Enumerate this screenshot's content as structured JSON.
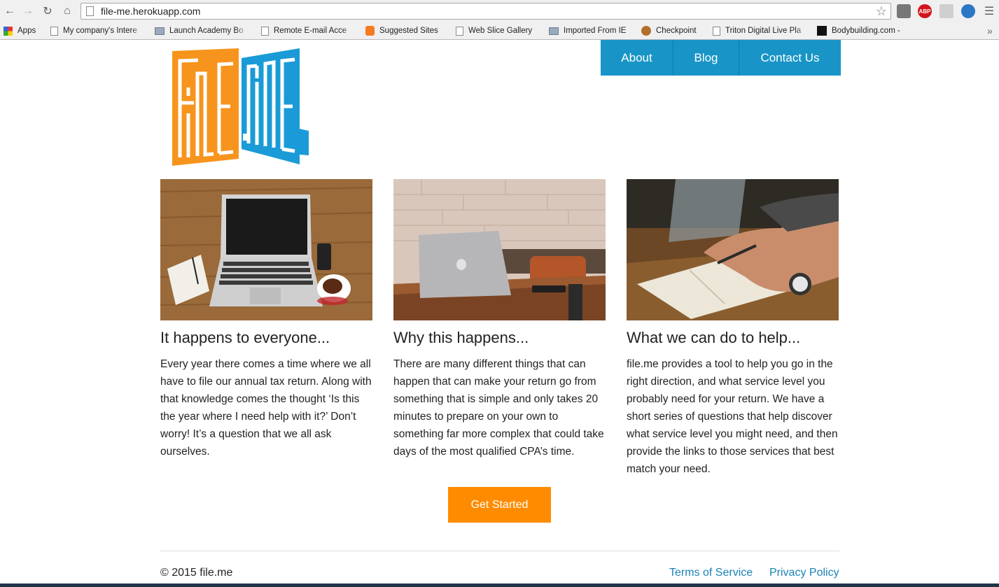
{
  "browser": {
    "url": "file-me.herokuapp.com",
    "extensions": {
      "abp_label": "ABP"
    },
    "bookmarks": [
      {
        "label": "Apps",
        "icon": "apps-icon"
      },
      {
        "label": "My company's Intere",
        "icon": "page-icon"
      },
      {
        "label": "Launch Academy Bo",
        "icon": "folder-icon"
      },
      {
        "label": "Remote E-mail Acce",
        "icon": "page-icon"
      },
      {
        "label": "Suggested Sites",
        "icon": "lightbulb-icon"
      },
      {
        "label": "Web Slice Gallery",
        "icon": "page-icon"
      },
      {
        "label": "Imported From IE",
        "icon": "folder-icon"
      },
      {
        "label": "Checkpoint",
        "icon": "checkpoint-icon"
      },
      {
        "label": "Triton Digital Live Pla",
        "icon": "page-icon"
      },
      {
        "label": "Bodybuilding.com -",
        "icon": "bodybuilding-icon"
      }
    ]
  },
  "nav": {
    "items": [
      "About",
      "Blog",
      "Contact Us"
    ]
  },
  "columns": [
    {
      "image": "laptop-on-wooden-desk",
      "title": "It happens to everyone...",
      "body": "Every year there comes a time where we all have to file our annual tax return. Along with that knowledge comes the thought ‘Is this the year where I need help with it?’ Don’t worry! It’s a question that we all ask ourselves."
    },
    {
      "image": "laptop-on-cafe-table",
      "title": "Why this happens...",
      "body": "There are many different things that can happen that can make your return go from something that is simple and only takes 20 minutes to prepare on your own to something far more complex that could take days of the most qualified CPA’s time."
    },
    {
      "image": "hand-writing-in-notebook",
      "title": "What we can do to help...",
      "body": "file.me provides a tool to help you go in the right direction, and what service level you probably need for your return. We have a short series of questions that help discover what service level you might need, and then provide the links to those services that best match your need."
    }
  ],
  "cta": {
    "label": "Get Started"
  },
  "footer": {
    "copyright": "© 2015 file.me",
    "links": [
      "Terms of Service",
      "Privacy Policy"
    ]
  },
  "colors": {
    "nav_blue": "#1895c6",
    "cta_orange": "#ff8c00",
    "logo_orange": "#f7941d",
    "logo_blue": "#1a9bd7",
    "link_blue": "#1b82b5"
  }
}
